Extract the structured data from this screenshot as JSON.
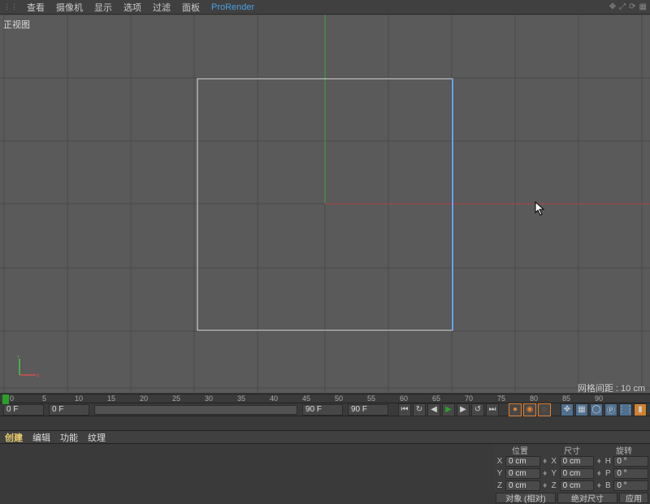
{
  "menubar": {
    "items": [
      "查看",
      "摄像机",
      "显示",
      "选项",
      "过滤",
      "面板"
    ],
    "pro": "ProRender"
  },
  "viewport": {
    "label": "正视图"
  },
  "grid_label": "网格间距 : 10 cm",
  "timeline": {
    "ticks": [
      "0",
      "5",
      "10",
      "15",
      "20",
      "25",
      "30",
      "35",
      "40",
      "45",
      "50",
      "55",
      "60",
      "65",
      "70",
      "75",
      "80",
      "85",
      "90"
    ],
    "current": "0 F",
    "range_start": "0 F",
    "range_end": "90 F",
    "total": "90 F"
  },
  "toolbar2": {
    "items": [
      "创建",
      "编辑",
      "功能",
      "纹理"
    ]
  },
  "coord": {
    "headers": [
      "位置",
      "尺寸",
      "旋转"
    ],
    "rows": [
      {
        "axis": "X",
        "pos": "0 cm",
        "sizeLbl": "X",
        "size": "0 cm",
        "rotLbl": "H",
        "rot": "0 °"
      },
      {
        "axis": "Y",
        "pos": "0 cm",
        "sizeLbl": "Y",
        "size": "0 cm",
        "rotLbl": "P",
        "rot": "0 °"
      },
      {
        "axis": "Z",
        "pos": "0 cm",
        "sizeLbl": "Z",
        "size": "0 cm",
        "rotLbl": "B",
        "rot": "0 °"
      }
    ],
    "footer": {
      "mode1": "对象 (相对)",
      "mode2": "绝对尺寸",
      "apply": "应用"
    }
  }
}
